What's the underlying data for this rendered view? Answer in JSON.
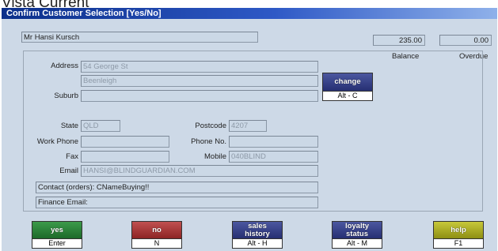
{
  "top_caption": "Vista Current",
  "window_title": "Confirm Customer Selection [Yes/No]",
  "customer_name": "Mr Hansi Kursch",
  "balance": {
    "label": "Balance",
    "value": "235.00"
  },
  "overdue": {
    "label": "Overdue",
    "value": "0.00"
  },
  "address": {
    "label": "Address",
    "line1": "54 George St",
    "line2": "Beenleigh"
  },
  "suburb": {
    "label": "Suburb",
    "value": ""
  },
  "state": {
    "label": "State",
    "value": "QLD"
  },
  "postcode": {
    "label": "Postcode",
    "value": "4207"
  },
  "work_phone": {
    "label": "Work Phone",
    "value": ""
  },
  "phone_no": {
    "label": "Phone No.",
    "value": ""
  },
  "fax": {
    "label": "Fax",
    "value": ""
  },
  "mobile": {
    "label": "Mobile",
    "value": "040BLIND"
  },
  "email": {
    "label": "Email",
    "value": "HANSI@BLINDGUARDIAN.COM"
  },
  "contact_orders": "Contact (orders): CNameBuying!!",
  "finance_email": "Finance Email:",
  "change_button": {
    "label": "change",
    "shortcut": "Alt - C"
  },
  "buttons": {
    "yes": {
      "label": "yes",
      "shortcut": "Enter"
    },
    "no": {
      "label": "no",
      "shortcut": "N"
    },
    "sales_history": {
      "label1": "sales",
      "label2": "history",
      "shortcut": "Alt - H"
    },
    "loyalty_status": {
      "label1": "loyalty",
      "label2": "status",
      "shortcut": "Alt - M"
    },
    "help": {
      "label": "help",
      "shortcut": "F1"
    }
  },
  "colors": {
    "title_bar": "#0b2f8a",
    "window_bg": "#cdd9e7",
    "yes": "#2a7f38",
    "no": "#a83232",
    "navy": "#343f88",
    "help": "#a9aa22"
  }
}
